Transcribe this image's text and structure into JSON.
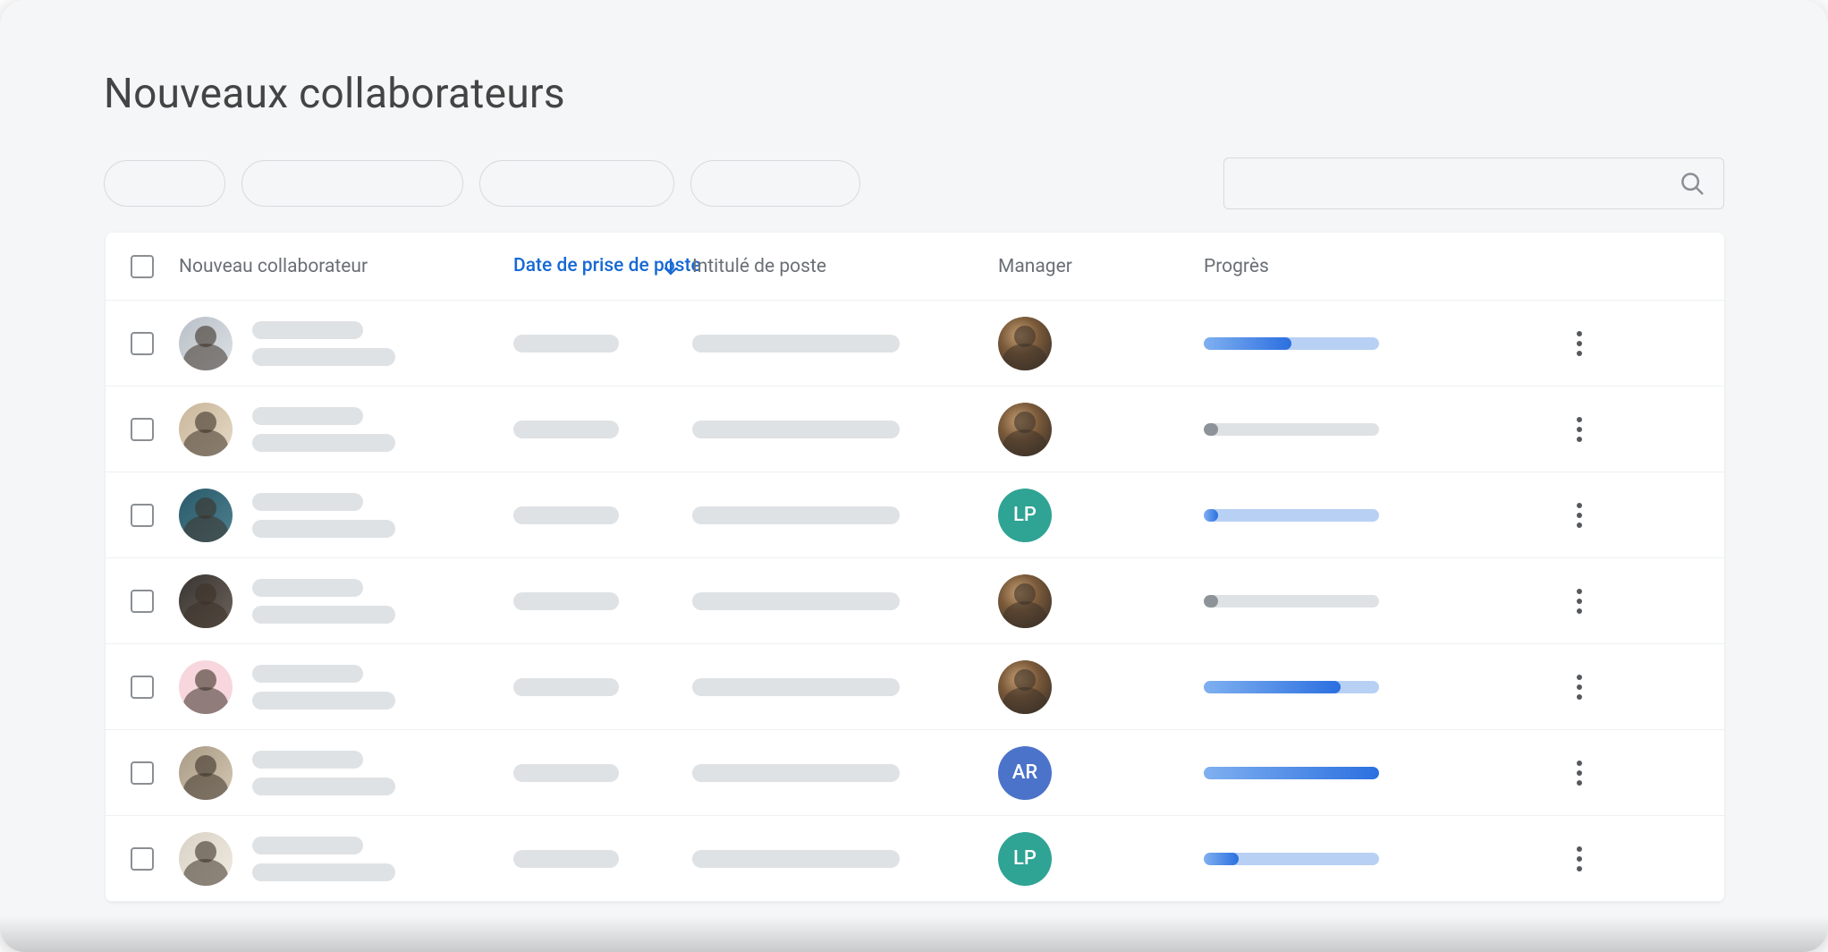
{
  "title": "Nouveaux collaborateurs",
  "search": {
    "placeholder": ""
  },
  "columns": {
    "collaborator": "Nouveau collaborateur",
    "start_date": "Date de prise de poste",
    "job_title": "Intitulé de poste",
    "manager": "Manager",
    "progress": "Progrès"
  },
  "sort": {
    "column": "start_date",
    "direction": "asc"
  },
  "rows": [
    {
      "avatar": {
        "type": "photo",
        "variant": "p1"
      },
      "manager": {
        "type": "photo",
        "variant": "mgr"
      },
      "progress": {
        "style": "blue",
        "value": 50
      }
    },
    {
      "avatar": {
        "type": "photo",
        "variant": "p2"
      },
      "manager": {
        "type": "photo",
        "variant": "mgr"
      },
      "progress": {
        "style": "grey",
        "value": 0
      }
    },
    {
      "avatar": {
        "type": "photo",
        "variant": "p3"
      },
      "manager": {
        "type": "initials",
        "initials": "LP",
        "color": "teal"
      },
      "progress": {
        "style": "blue",
        "value": 8
      }
    },
    {
      "avatar": {
        "type": "photo",
        "variant": "p4"
      },
      "manager": {
        "type": "photo",
        "variant": "mgr"
      },
      "progress": {
        "style": "grey",
        "value": 0
      }
    },
    {
      "avatar": {
        "type": "photo",
        "variant": "p5"
      },
      "manager": {
        "type": "photo",
        "variant": "mgr"
      },
      "progress": {
        "style": "blue",
        "value": 78
      }
    },
    {
      "avatar": {
        "type": "photo",
        "variant": "p6"
      },
      "manager": {
        "type": "initials",
        "initials": "AR",
        "color": "blue"
      },
      "progress": {
        "style": "blue",
        "value": 100
      }
    },
    {
      "avatar": {
        "type": "photo",
        "variant": "p7"
      },
      "manager": {
        "type": "initials",
        "initials": "LP",
        "color": "teal"
      },
      "progress": {
        "style": "blue",
        "value": 20
      }
    }
  ]
}
